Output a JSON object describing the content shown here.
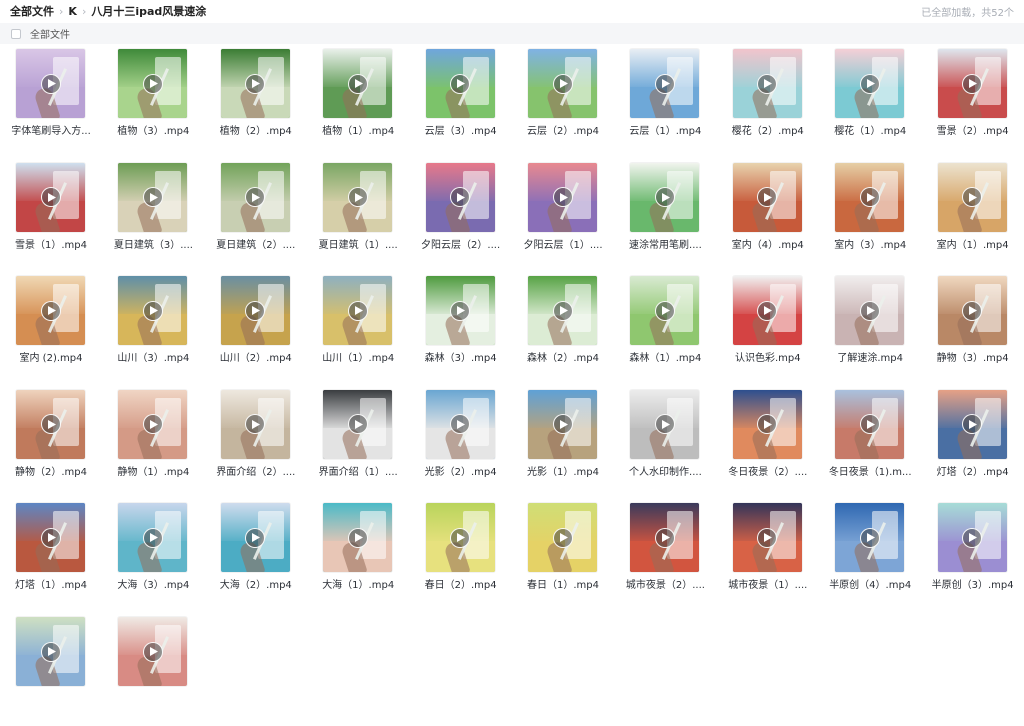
{
  "breadcrumb": {
    "items": [
      "全部文件",
      "K",
      "八月十三ipad风景速涂"
    ]
  },
  "status_text": "已全部加载，共52个",
  "select_all_label": "全部文件",
  "files": [
    {
      "name": "字体笔刷导入方...",
      "colors": [
        "#d9c6e6",
        "#b8a1d4"
      ]
    },
    {
      "name": "植物（3）.mp4",
      "colors": [
        "#3f8a3a",
        "#a9d48d"
      ]
    },
    {
      "name": "植物（2）.mp4",
      "colors": [
        "#3b7d34",
        "#c9d9b8"
      ]
    },
    {
      "name": "植物（1）.mp4",
      "colors": [
        "#e9f0ea",
        "#5f9b55"
      ]
    },
    {
      "name": "云层（3）.mp4",
      "colors": [
        "#6fa6dd",
        "#7cc36a"
      ]
    },
    {
      "name": "云层（2）.mp4",
      "colors": [
        "#7fb2e4",
        "#86c36d"
      ]
    },
    {
      "name": "云层（1）.mp4",
      "colors": [
        "#e8eef4",
        "#6ea8d8"
      ]
    },
    {
      "name": "樱花（2）.mp4",
      "colors": [
        "#f1c4cc",
        "#9ad2d8"
      ]
    },
    {
      "name": "樱花（1）.mp4",
      "colors": [
        "#f4cfd6",
        "#7ccad3"
      ]
    },
    {
      "name": "雪景（2）.mp4",
      "colors": [
        "#dfe6ee",
        "#c94c4c"
      ]
    },
    {
      "name": "雪景（1）.mp4",
      "colors": [
        "#cfe0ef",
        "#c24646"
      ]
    },
    {
      "name": "夏日建筑（3）....",
      "colors": [
        "#6d9d55",
        "#d9d2b8"
      ]
    },
    {
      "name": "夏日建筑（2）....",
      "colors": [
        "#72a35a",
        "#c8cfb2"
      ]
    },
    {
      "name": "夏日建筑（1）....",
      "colors": [
        "#7aa664",
        "#d6cfa9"
      ]
    },
    {
      "name": "夕阳云层（2）....",
      "colors": [
        "#e7798a",
        "#7a6bb0"
      ]
    },
    {
      "name": "夕阳云层（1）....",
      "colors": [
        "#e8898f",
        "#8a6fb8"
      ]
    },
    {
      "name": "速涂常用笔刷....",
      "colors": [
        "#f1f4ee",
        "#69b86c"
      ]
    },
    {
      "name": "室内（4）.mp4",
      "colors": [
        "#e8d3ae",
        "#c75a3a"
      ]
    },
    {
      "name": "室内（3）.mp4",
      "colors": [
        "#e6cfa6",
        "#c9683f"
      ]
    },
    {
      "name": "室内（1）.mp4",
      "colors": [
        "#ece3cf",
        "#d7a567"
      ]
    },
    {
      "name": "室内 (2).mp4",
      "colors": [
        "#f0d8b4",
        "#d58e52"
      ]
    },
    {
      "name": "山川（3）.mp4",
      "colors": [
        "#5f8fa8",
        "#d7b65a"
      ]
    },
    {
      "name": "山川（2）.mp4",
      "colors": [
        "#6a8fa2",
        "#c6a34d"
      ]
    },
    {
      "name": "山川（1）.mp4",
      "colors": [
        "#8eb0c0",
        "#d8c06a"
      ]
    },
    {
      "name": "森林（3）.mp4",
      "colors": [
        "#4f9b3f",
        "#e4efe0"
      ]
    },
    {
      "name": "森林（2）.mp4",
      "colors": [
        "#58a346",
        "#dcecd4"
      ]
    },
    {
      "name": "森林（1）.mp4",
      "colors": [
        "#d9ead2",
        "#8fc76f"
      ]
    },
    {
      "name": "认识色彩.mp4",
      "colors": [
        "#f1f1f1",
        "#d44343"
      ]
    },
    {
      "name": "了解速涂.mp4",
      "colors": [
        "#f1eeee",
        "#c9b3b3"
      ]
    },
    {
      "name": "静物（3）.mp4",
      "colors": [
        "#f0d8c0",
        "#b98866"
      ]
    },
    {
      "name": "静物（2）.mp4",
      "colors": [
        "#efd3bd",
        "#c07a5c"
      ]
    },
    {
      "name": "静物（1）.mp4",
      "colors": [
        "#f0d5c4",
        "#d49a86"
      ]
    },
    {
      "name": "界面介绍（2）....",
      "colors": [
        "#eee8df",
        "#c4b59e"
      ]
    },
    {
      "name": "界面介绍（1）....",
      "colors": [
        "#3a3d40",
        "#e3e3e3"
      ]
    },
    {
      "name": "光影（2）.mp4",
      "colors": [
        "#6aa6d2",
        "#e5e5e5"
      ]
    },
    {
      "name": "光影（1）.mp4",
      "colors": [
        "#5fa1d6",
        "#b7a27d"
      ]
    },
    {
      "name": "个人水印制作....",
      "colors": [
        "#ececec",
        "#bdbdbd"
      ]
    },
    {
      "name": "冬日夜景（2）....",
      "colors": [
        "#2d4f8f",
        "#e08a5e"
      ]
    },
    {
      "name": "冬日夜景（1).m...",
      "colors": [
        "#a9c1de",
        "#c77a69"
      ]
    },
    {
      "name": "灯塔（2）.mp4",
      "colors": [
        "#e6a186",
        "#4a6fa3"
      ]
    },
    {
      "name": "灯塔（1）.mp4",
      "colors": [
        "#5d86c4",
        "#b9583f"
      ]
    },
    {
      "name": "大海（3）.mp4",
      "colors": [
        "#c7d6ec",
        "#5fb5c9"
      ]
    },
    {
      "name": "大海（2）.mp4",
      "colors": [
        "#cfdcee",
        "#4cacc4"
      ]
    },
    {
      "name": "大海（1）.mp4",
      "colors": [
        "#4bbac7",
        "#e8c6b6"
      ]
    },
    {
      "name": "春日（2）.mp4",
      "colors": [
        "#b9d45c",
        "#e7e17e"
      ]
    },
    {
      "name": "春日（1）.mp4",
      "colors": [
        "#cfde76",
        "#e5d266"
      ]
    },
    {
      "name": "城市夜景（2）....",
      "colors": [
        "#3a3a5c",
        "#d2553f"
      ]
    },
    {
      "name": "城市夜景（1）....",
      "colors": [
        "#33355a",
        "#d86246"
      ]
    },
    {
      "name": "半原创（4）.mp4",
      "colors": [
        "#2f68b2",
        "#7da5d6"
      ]
    },
    {
      "name": "半原创（3）.mp4",
      "colors": [
        "#a7dcd7",
        "#9b8ed2"
      ]
    },
    {
      "name": "",
      "colors": [
        "#cfe0c2",
        "#8ab0d6"
      ]
    },
    {
      "name": "",
      "colors": [
        "#f0eae5",
        "#d88b84"
      ]
    }
  ]
}
